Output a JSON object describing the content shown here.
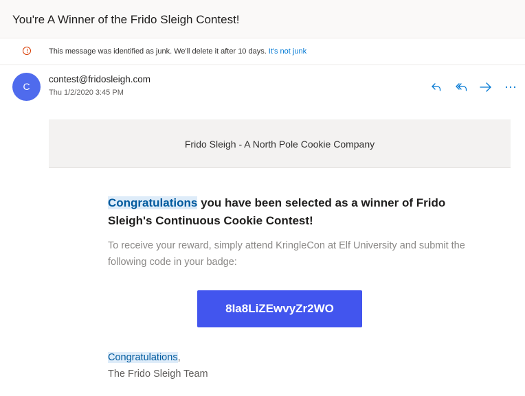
{
  "email": {
    "subject": "You're A Winner of the Frido Sleigh Contest!",
    "junk_notice": {
      "message": "This message was identified as junk. We'll delete it after 10 days.",
      "link_label": "It's not junk"
    },
    "sender": {
      "avatar_initial": "C",
      "address": "contest@fridosleigh.com",
      "date": "Thu 1/2/2020 3:45 PM"
    },
    "actions": [
      {
        "name": "reply",
        "icon": "reply-icon"
      },
      {
        "name": "reply-all",
        "icon": "reply-all-icon"
      },
      {
        "name": "forward",
        "icon": "forward-icon"
      },
      {
        "name": "more",
        "icon": "more-icon"
      }
    ]
  },
  "body": {
    "banner": "Frido Sleigh - A North Pole Cookie Company",
    "headline_highlight": "Congratulations",
    "headline_rest": " you have been selected as a winner of Frido Sleigh's Continuous Cookie Contest!",
    "instructions": "To receive your reward, simply attend KringleCon at Elf University and submit the following code in your badge:",
    "code": "8Ia8LiZEwvyZr2WO",
    "signoff_highlight": "Congratulations",
    "signoff_punct": ",",
    "signoff_team": "The Frido Sleigh Team"
  },
  "colors": {
    "avatar": "#4f6bed",
    "code_button": "#4255ee",
    "link": "#0078d4",
    "junk_icon": "#d83b01"
  }
}
